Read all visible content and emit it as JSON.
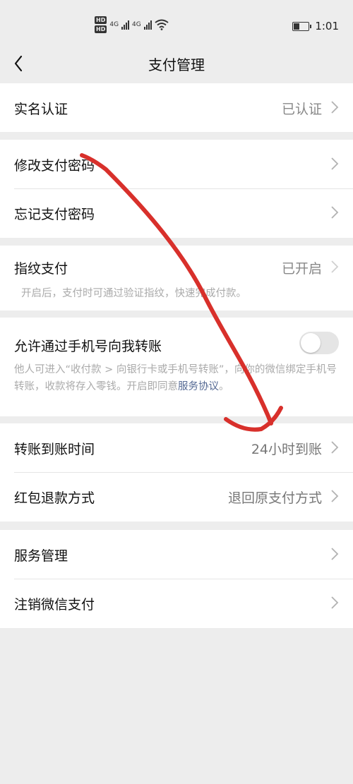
{
  "status_bar": {
    "hd1": "HD",
    "hd2": "HD",
    "net1": "4G",
    "net2": "4G",
    "battery_level": 0.35,
    "time": "1:01"
  },
  "nav": {
    "title": "支付管理"
  },
  "groups": {
    "verify": {
      "label": "实名认证",
      "value": "已认证"
    },
    "password": {
      "change": "修改支付密码",
      "forgot": "忘记支付密码"
    },
    "fingerprint": {
      "label": "指纹支付",
      "value": "已开启",
      "desc": "开启后，支付时可通过验证指纹，快速完成付款。"
    },
    "phone_transfer": {
      "label": "允许通过手机号向我转账",
      "toggle_on": false,
      "desc": "他人可进入“收付款 > 向银行卡或手机号转账”，向你的微信绑定手机号转账，收款将存入零钱。开启即同意",
      "link": "服务协议",
      "desc_end": "。"
    },
    "transfer": {
      "arrival_label": "转账到账时间",
      "arrival_value": "24小时到账",
      "refund_label": "红包退款方式",
      "refund_value": "退回原支付方式"
    },
    "service": {
      "manage": "服务管理",
      "cancel": "注销微信支付"
    }
  },
  "colors": {
    "background": "#ededed",
    "link": "#576b95",
    "annotation": "#d8302b"
  }
}
